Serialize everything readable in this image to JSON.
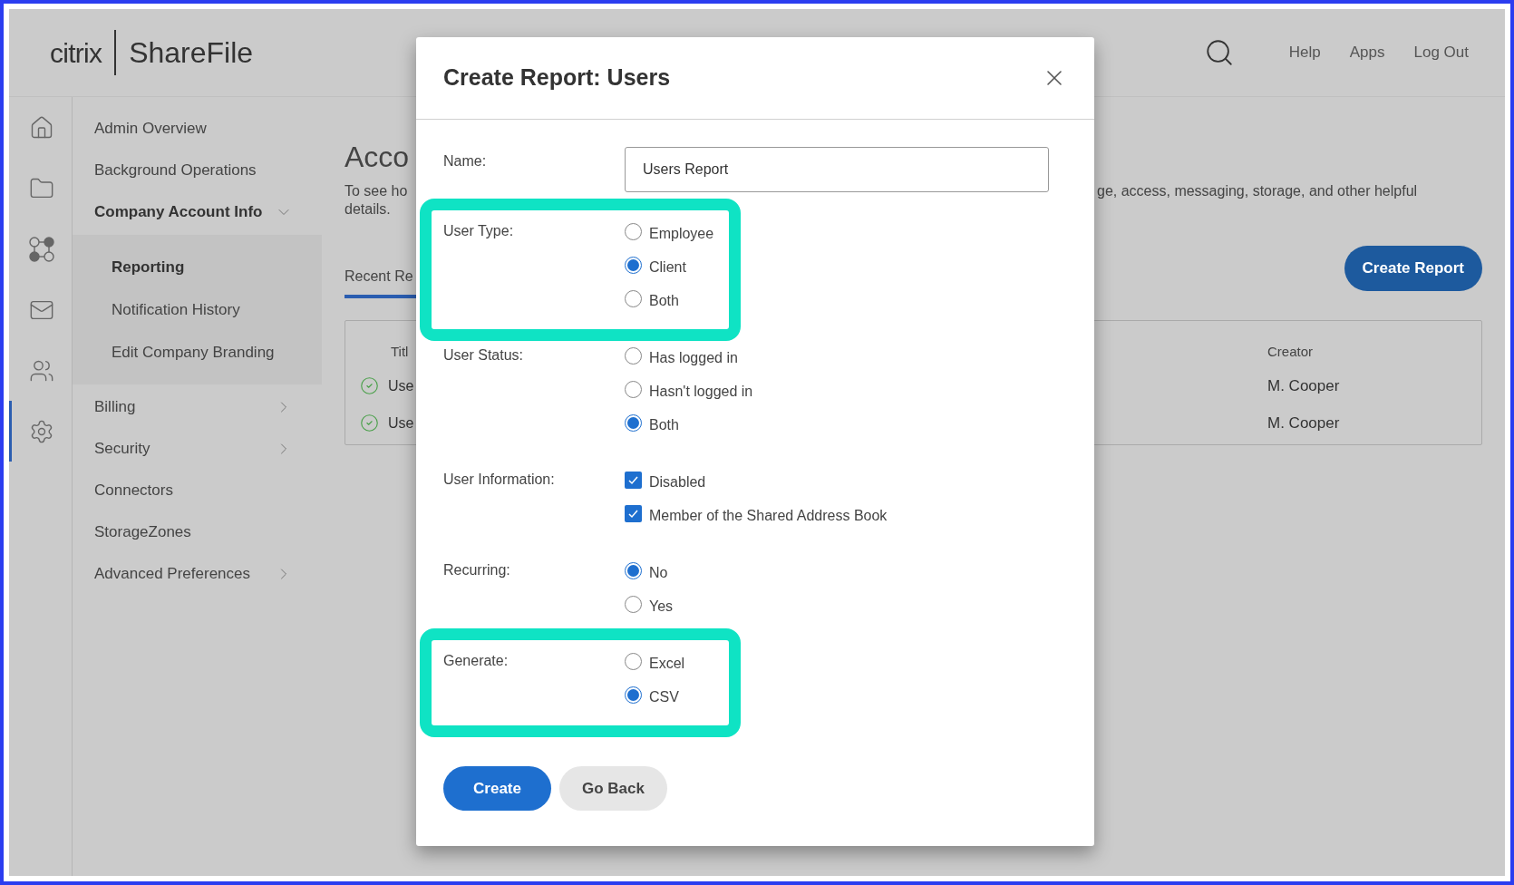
{
  "header": {
    "logo_left": "citrix",
    "logo_right": "ShareFile",
    "links": [
      "Help",
      "Apps",
      "Log Out"
    ]
  },
  "icon_rail": [
    {
      "kind": "home",
      "selected": false
    },
    {
      "kind": "folder",
      "selected": false
    },
    {
      "kind": "workflow",
      "selected": false
    },
    {
      "kind": "mail",
      "selected": false
    },
    {
      "kind": "users",
      "selected": false
    },
    {
      "kind": "settings",
      "selected": true
    }
  ],
  "sidebar": {
    "items": [
      {
        "label": "Admin Overview",
        "selected": false
      },
      {
        "label": "Background Operations",
        "selected": false
      },
      {
        "label": "Company Account Info",
        "selected": true,
        "expanded": true,
        "children": [
          {
            "label": "Reporting",
            "selected": true
          },
          {
            "label": "Notification History",
            "selected": false
          },
          {
            "label": "Edit Company Branding",
            "selected": false
          }
        ]
      },
      {
        "label": "Billing",
        "selected": false,
        "expanded": false
      },
      {
        "label": "Security",
        "selected": false,
        "expanded": false
      },
      {
        "label": "Connectors",
        "selected": false
      },
      {
        "label": "StorageZones",
        "selected": false
      },
      {
        "label": "Advanced Preferences",
        "selected": false,
        "expanded": false
      }
    ]
  },
  "main": {
    "title": "Acco",
    "description_left": [
      "To see ho",
      "details."
    ],
    "description_right": "ge, access, messaging, storage, and other helpful",
    "tab": "Recent Re",
    "create_button": "Create Report",
    "table": {
      "columns": [
        "Titl",
        "Creator"
      ],
      "rows": [
        {
          "title": "Use",
          "creator": "M. Cooper"
        },
        {
          "title": "Use",
          "creator": "M. Cooper"
        }
      ]
    }
  },
  "dialog": {
    "title": "Create Report: Users",
    "fields": [
      {
        "kind": "text",
        "label": "Name:",
        "value": "Users Report",
        "highlighted": false
      },
      {
        "kind": "radio",
        "label": "User Type:",
        "highlighted": true,
        "options": [
          {
            "label": "Employee",
            "selected": false
          },
          {
            "label": "Client",
            "selected": true
          },
          {
            "label": "Both",
            "selected": false
          }
        ]
      },
      {
        "kind": "radio",
        "label": "User Status:",
        "highlighted": false,
        "options": [
          {
            "label": "Has logged in",
            "selected": false
          },
          {
            "label": "Hasn't logged in",
            "selected": false
          },
          {
            "label": "Both",
            "selected": true
          }
        ]
      },
      {
        "kind": "checkbox",
        "label": "User Information:",
        "highlighted": false,
        "options": [
          {
            "label": "Disabled",
            "checked": true
          },
          {
            "label": "Member of the Shared Address Book",
            "checked": true
          }
        ]
      },
      {
        "kind": "radio",
        "label": "Recurring:",
        "highlighted": false,
        "options": [
          {
            "label": "No",
            "selected": true
          },
          {
            "label": "Yes",
            "selected": false
          }
        ]
      },
      {
        "kind": "radio",
        "label": "Generate:",
        "highlighted": true,
        "options": [
          {
            "label": "Excel",
            "selected": false
          },
          {
            "label": "CSV",
            "selected": true
          }
        ]
      }
    ],
    "buttons": [
      {
        "label": "Create",
        "kind": "primary"
      },
      {
        "label": "Go Back",
        "kind": "secondary"
      }
    ]
  }
}
